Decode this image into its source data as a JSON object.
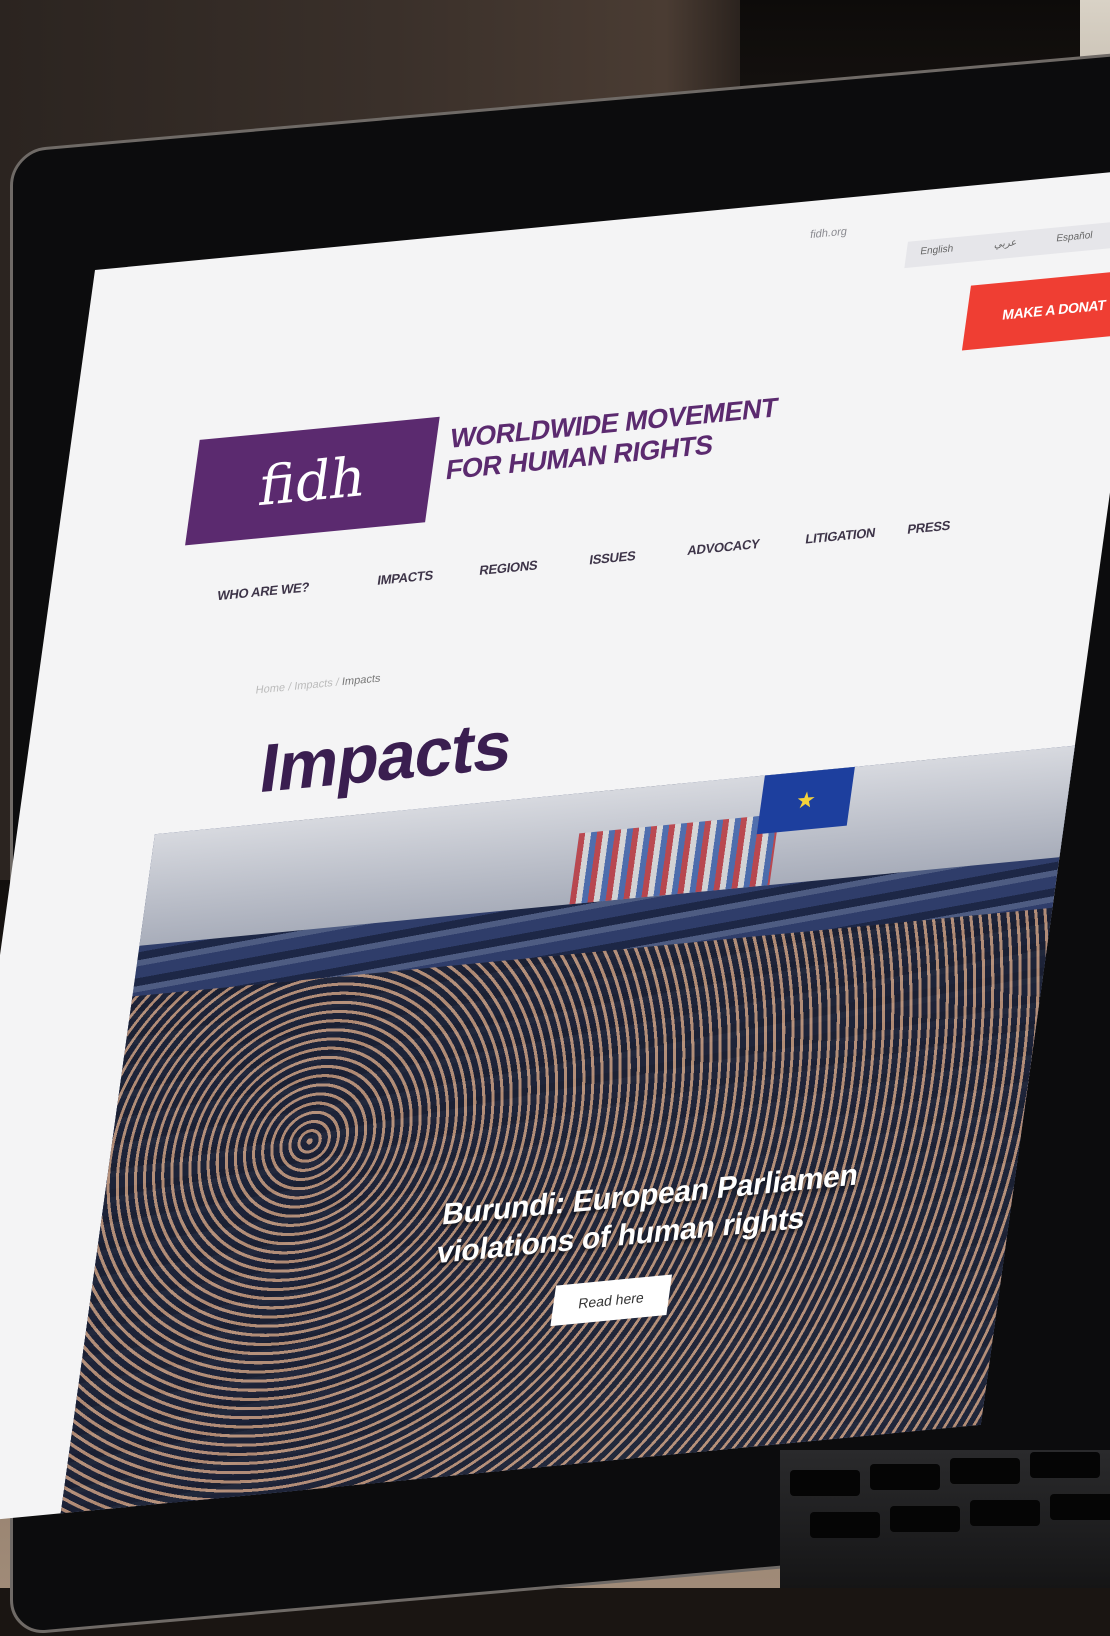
{
  "browser": {
    "url": "fidh.org"
  },
  "languages": [
    "English",
    "عربي",
    "Español"
  ],
  "donate_label": "MAKE A DONAT",
  "logo_text": "fidh",
  "org_title": [
    "WORLDWIDE MOVEMENT",
    "FOR HUMAN RIGHTS"
  ],
  "nav": [
    "WHO ARE WE?",
    "IMPACTS",
    "REGIONS",
    "ISSUES",
    "ADVOCACY",
    "LITIGATION",
    "PRESS"
  ],
  "breadcrumb": {
    "trail": "Home / Impacts / ",
    "current": "Impacts"
  },
  "page_title": "Impacts",
  "hero": {
    "headline": [
      "Burundi: European Parliamen",
      "violations of human rights"
    ],
    "button": "Read here"
  },
  "colors": {
    "brand_purple": "#5b2a6f",
    "donate_red": "#ef3e33",
    "title_purple": "#3a1e50"
  }
}
